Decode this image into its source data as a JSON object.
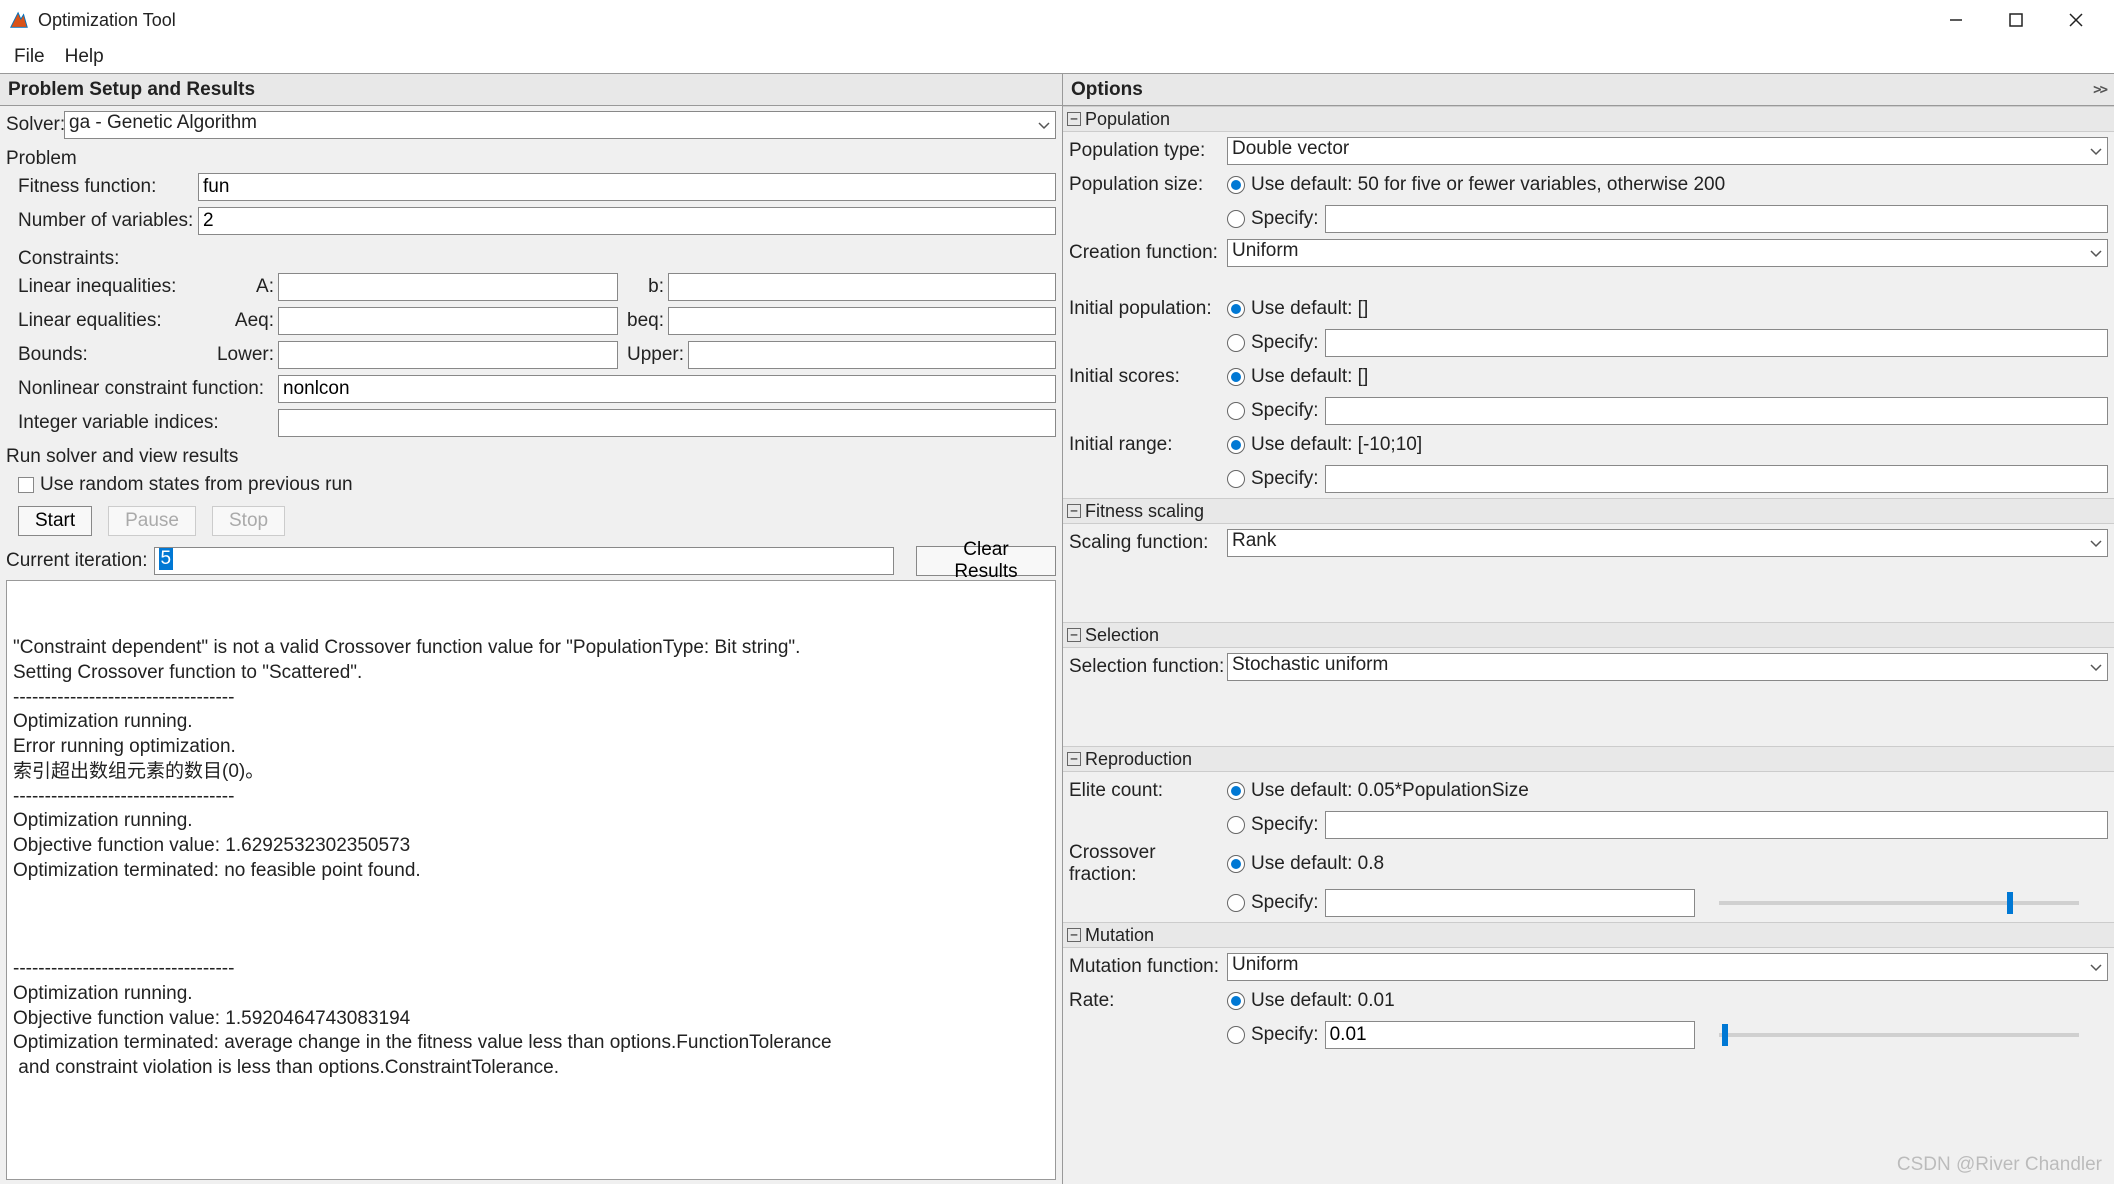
{
  "window": {
    "title": "Optimization Tool"
  },
  "menubar": {
    "file": "File",
    "help": "Help"
  },
  "left": {
    "header": "Problem Setup and Results",
    "solver_label": "Solver:",
    "solver_value": "ga - Genetic Algorithm",
    "problem_label": "Problem",
    "fitness_label": "Fitness function:",
    "fitness_value": "fun",
    "nvars_label": "Number of variables:",
    "nvars_value": "2",
    "constraints_label": "Constraints:",
    "lineq_label": "Linear inequalities:",
    "A_label": "A:",
    "b_label": "b:",
    "leq_label": "Linear equalities:",
    "Aeq_label": "Aeq:",
    "beq_label": "beq:",
    "bounds_label": "Bounds:",
    "lower_label": "Lower:",
    "upper_label": "Upper:",
    "nonlcon_label": "Nonlinear constraint function:",
    "nonlcon_value": "nonlcon",
    "intvar_label": "Integer variable indices:",
    "run_label": "Run solver and view results",
    "random_label": "Use random states from previous run",
    "start": "Start",
    "pause": "Pause",
    "stop": "Stop",
    "curiter_label": "Current iteration:",
    "curiter_value": "5",
    "clear": "Clear Results",
    "results": "\n\n\"Constraint dependent\" is not a valid Crossover function value for \"PopulationType: Bit string\".\nSetting Crossover function to \"Scattered\".\n-----------------------------------\nOptimization running.\nError running optimization.\n索引超出数组元素的数目(0)。\n-----------------------------------\nOptimization running.\nObjective function value: 1.6292532302350573\nOptimization terminated: no feasible point found.\n\n\n\n-----------------------------------\nOptimization running.\nObjective function value: 1.5920464743083194\nOptimization terminated: average change in the fitness value less than options.FunctionTolerance\n and constraint violation is less than options.ConstraintTolerance."
  },
  "right": {
    "header": "Options",
    "population": {
      "title": "Population",
      "type_label": "Population type:",
      "type_value": "Double vector",
      "size_label": "Population size:",
      "size_default": "Use default: 50 for five or fewer variables, otherwise 200",
      "specify": "Specify:",
      "creation_label": "Creation function:",
      "creation_value": "Uniform",
      "initpop_label": "Initial population:",
      "initpop_default": "Use default: []",
      "initscores_label": "Initial scores:",
      "initscores_default": "Use default: []",
      "initrange_label": "Initial range:",
      "initrange_default": "Use default: [-10;10]"
    },
    "fitness_scaling": {
      "title": "Fitness scaling",
      "scaling_label": "Scaling function:",
      "scaling_value": "Rank"
    },
    "selection": {
      "title": "Selection",
      "label": "Selection function:",
      "value": "Stochastic uniform"
    },
    "reproduction": {
      "title": "Reproduction",
      "elite_label": "Elite count:",
      "elite_default": "Use default: 0.05*PopulationSize",
      "specify": "Specify:",
      "crossover_label": "Crossover fraction:",
      "crossover_default": "Use default: 0.8"
    },
    "mutation": {
      "title": "Mutation",
      "func_label": "Mutation function:",
      "func_value": "Uniform",
      "rate_label": "Rate:",
      "rate_default": "Use default: 0.01",
      "specify": "Specify:",
      "rate_specify_value": "0.01"
    }
  },
  "watermark": "CSDN @River Chandler"
}
